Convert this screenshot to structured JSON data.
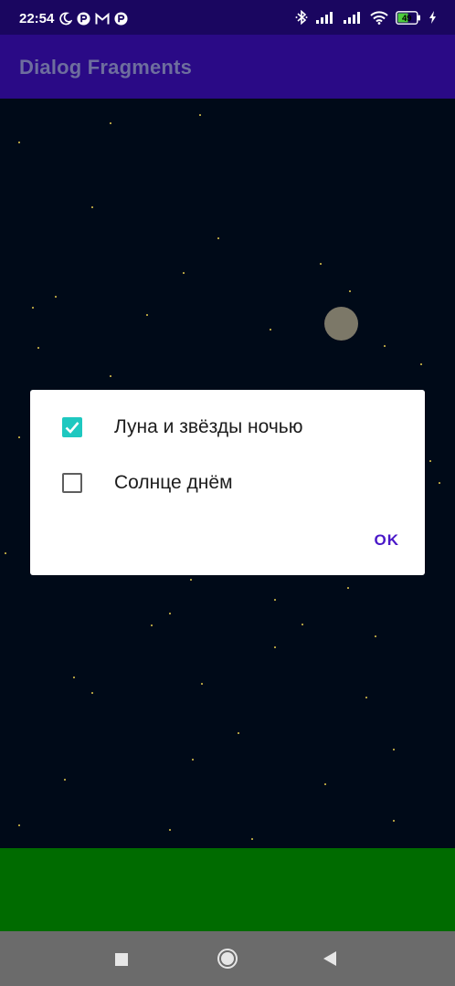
{
  "status_bar": {
    "time": "22:54",
    "battery": "49",
    "icons": [
      "moon-icon",
      "app-notification-icon",
      "gmail-icon",
      "app-notification-icon",
      "bluetooth-icon",
      "signal-icon",
      "signal-icon",
      "wifi-icon",
      "battery-icon",
      "charging-icon"
    ]
  },
  "app_bar": {
    "title": "Dialog Fragments"
  },
  "dialog": {
    "options": [
      {
        "label": "Луна и звёзды ночью",
        "checked": true
      },
      {
        "label": "Солнце днём",
        "checked": false
      }
    ],
    "ok_label": "OK"
  },
  "colors": {
    "status_bar": "#1a0660",
    "app_bar": "#2a0a86",
    "sky": "#000a18",
    "moon": "#7c7868",
    "ground": "#006b00",
    "checkbox_accent": "#1ec8c0",
    "button_text": "#4a18c8",
    "nav_bar": "#6b6b6b"
  },
  "nav_bar": {
    "icons": [
      "recents-square-icon",
      "home-circle-icon",
      "back-triangle-icon"
    ]
  }
}
